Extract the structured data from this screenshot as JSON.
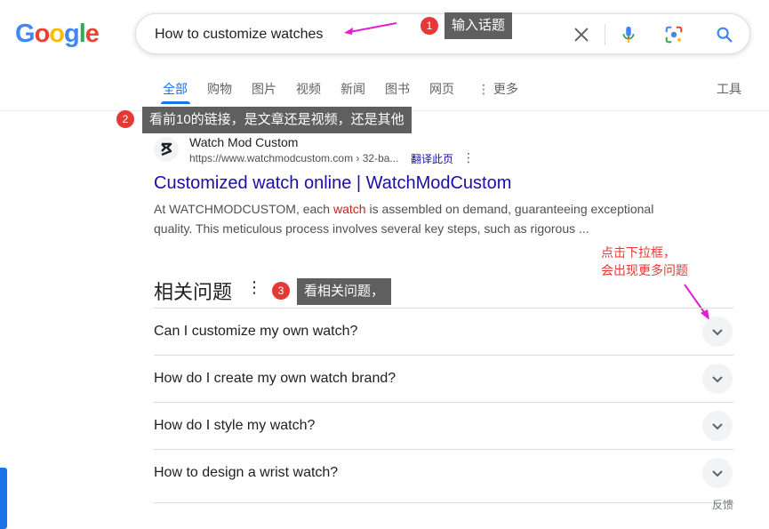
{
  "logo": {
    "letters": [
      "G",
      "o",
      "o",
      "g",
      "l",
      "e"
    ],
    "colors": [
      "#4285F4",
      "#EA4335",
      "#FBBC05",
      "#4285F4",
      "#34A853",
      "#EA4335"
    ]
  },
  "search": {
    "query": "How to customize watches"
  },
  "tabs": [
    "全部",
    "购物",
    "图片",
    "视频",
    "新闻",
    "图书",
    "网页",
    "⋮ 更多"
  ],
  "tools_label": "工具",
  "annotations": [
    {
      "num": "1",
      "text": "输入话题"
    },
    {
      "num": "2",
      "text": "看前10的链接，是文章还是视频，还是其他"
    },
    {
      "num": "3",
      "text": "看相关问题，"
    }
  ],
  "red_note": {
    "line1": "点击下拉框，",
    "line2": "会出现更多问题"
  },
  "result": {
    "site_name": "Watch Mod Custom",
    "url": "https://www.watchmodcustom.com › 32-ba...",
    "translate": "翻译此页",
    "title": "Customized watch online | WatchModCustom",
    "snippet_pre": "At WATCHMODCUSTOM, each ",
    "snippet_highlight": "watch",
    "snippet_post": " is assembled on demand, guaranteeing exceptional quality. This meticulous process involves several key steps, such as rigorous ..."
  },
  "paa": {
    "title": "相关问题",
    "questions": [
      "Can I customize my own watch?",
      "How do I create my own watch brand?",
      "How do I style my watch?",
      "How to design a wrist watch?"
    ]
  },
  "feedback": "反馈",
  "colors": {
    "accent": "#1a73e8",
    "link": "#1a0dab",
    "annotation_red": "#e53935",
    "arrow_magenta": "#e020d0"
  }
}
